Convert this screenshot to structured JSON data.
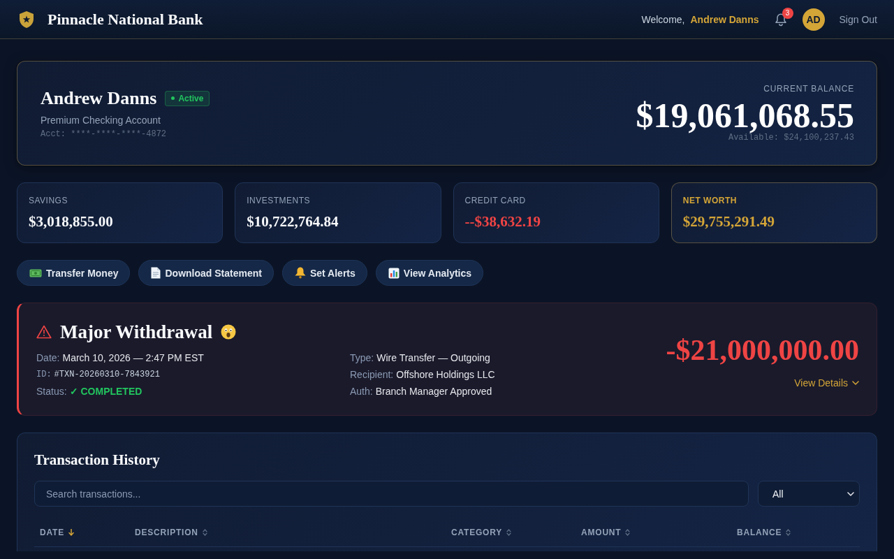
{
  "header": {
    "brand": "Pinnacle National Bank",
    "welcome": "Welcome,",
    "user_name": "Andrew Danns",
    "notification_count": "3",
    "avatar_initials": "AD",
    "sign_out": "Sign Out"
  },
  "account": {
    "holder": "Andrew Danns",
    "status": "Active",
    "type": "Premium Checking Account",
    "account_number": "Acct: ****-****-****-4872",
    "balance_label": "CURRENT BALANCE",
    "balance": "$19,061,068.55",
    "available": "Available: $24,100,237.43"
  },
  "summary_cards": [
    {
      "label": "SAVINGS",
      "value": "$3,018,855.00",
      "kind": "plain"
    },
    {
      "label": "INVESTMENTS",
      "value": "$10,722,764.84",
      "kind": "plain"
    },
    {
      "label": "CREDIT CARD",
      "value": "--$38,632.19",
      "kind": "debt"
    },
    {
      "label": "NET WORTH",
      "value": "$29,755,291.49",
      "kind": "total"
    }
  ],
  "actions": [
    {
      "label": "Transfer Money",
      "kind": "transfer"
    },
    {
      "label": "Download Statement",
      "kind": "statement"
    },
    {
      "label": "Set Alerts",
      "kind": "alerts"
    },
    {
      "label": "View Analytics",
      "kind": "analytics"
    }
  ],
  "alert": {
    "title": "Major Withdrawal",
    "detail_columns": [
      {
        "rows": [
          {
            "label": "Date:",
            "value": "March 10, 2026 — 2:47 PM EST",
            "kind": "text"
          },
          {
            "label": "ID:",
            "value": "#TXN-20260310-7843921",
            "kind": "mono"
          },
          {
            "label": "Status:",
            "value": "✓ COMPLETED",
            "kind": "status"
          }
        ]
      },
      {
        "rows": [
          {
            "label": "Type:",
            "value": "Wire Transfer — Outgoing",
            "kind": "text"
          },
          {
            "label": "Recipient:",
            "value": "Offshore Holdings LLC",
            "kind": "text"
          },
          {
            "label": "Auth:",
            "value": "Branch Manager Approved",
            "kind": "text"
          }
        ]
      }
    ],
    "amount": "-$21,000,000.00",
    "link": "View Details"
  },
  "transactions": {
    "title": "Transaction History",
    "search": {
      "placeholder": "Search transactions..."
    },
    "filter": {
      "value": "All"
    },
    "columns": [
      {
        "label": "DATE",
        "sorted": true
      },
      {
        "label": "DESCRIPTION",
        "sorted": false
      },
      {
        "label": "CATEGORY",
        "sorted": false
      },
      {
        "label": "AMOUNT",
        "sorted": false
      },
      {
        "label": "BALANCE",
        "sorted": false
      }
    ]
  }
}
